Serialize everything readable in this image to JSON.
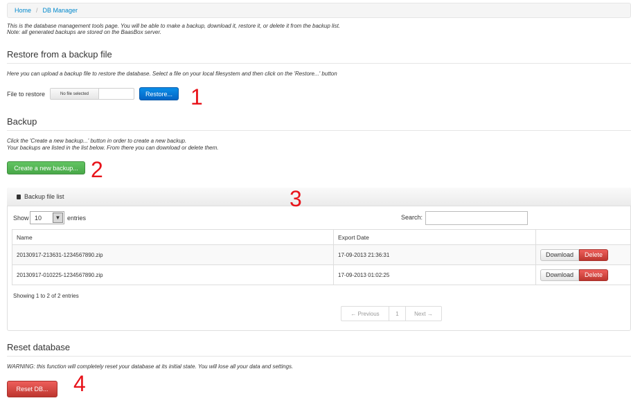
{
  "breadcrumb": {
    "home": "Home",
    "separator": "/",
    "current": "DB Manager"
  },
  "intro": {
    "line1": "This is the database management tools page. You will be able to make a backup, download it, restore it, or delete it from the backup list.",
    "line2": "Note: all generated backups are stored on the BaasBox server."
  },
  "restore": {
    "title": "Restore from a backup file",
    "note": "Here you can upload a backup file to restore the database. Select a file on your local filesystem and then click on the 'Restore...' button",
    "file_label": "File to restore",
    "file_value": "No file selected",
    "button": "Restore..."
  },
  "backup": {
    "title": "Backup",
    "note1": "Click the 'Create a new backup...' button in order to create a new backup.",
    "note2": "Your backups are listed in the list below. From there you can download or delete them.",
    "button": "Create a new backup..."
  },
  "backup_list": {
    "title": "Backup file list",
    "show_label": "Show",
    "page_size": "10",
    "entries_label": "entries",
    "search_label": "Search:",
    "search_value": "",
    "columns": [
      "Name",
      "Export Date",
      ""
    ],
    "rows": [
      {
        "name": "20130917-213631-1234567890.zip",
        "date": "17-09-2013 21:36:31",
        "download": "Download",
        "delete": "Delete"
      },
      {
        "name": "20130917-010225-1234567890.zip",
        "date": "17-09-2013 01:02:25",
        "download": "Download",
        "delete": "Delete"
      }
    ],
    "info": "Showing 1 to 2 of 2 entries",
    "pager": {
      "previous": "← Previous",
      "page": "1",
      "next": "Next →"
    }
  },
  "reset": {
    "title": "Reset database",
    "warning": "WARNING: this function will completely reset your database at its initial state. You will lose all your data and settings.",
    "button": "Reset DB..."
  },
  "annotations": {
    "m1": "1",
    "m2": "2",
    "m3": "3",
    "m4": "4"
  },
  "colors": {
    "link": "#0088cc",
    "primary": "#0b8ee8",
    "success": "#62c462",
    "danger": "#da4f49",
    "annotation": "#e8141b"
  }
}
